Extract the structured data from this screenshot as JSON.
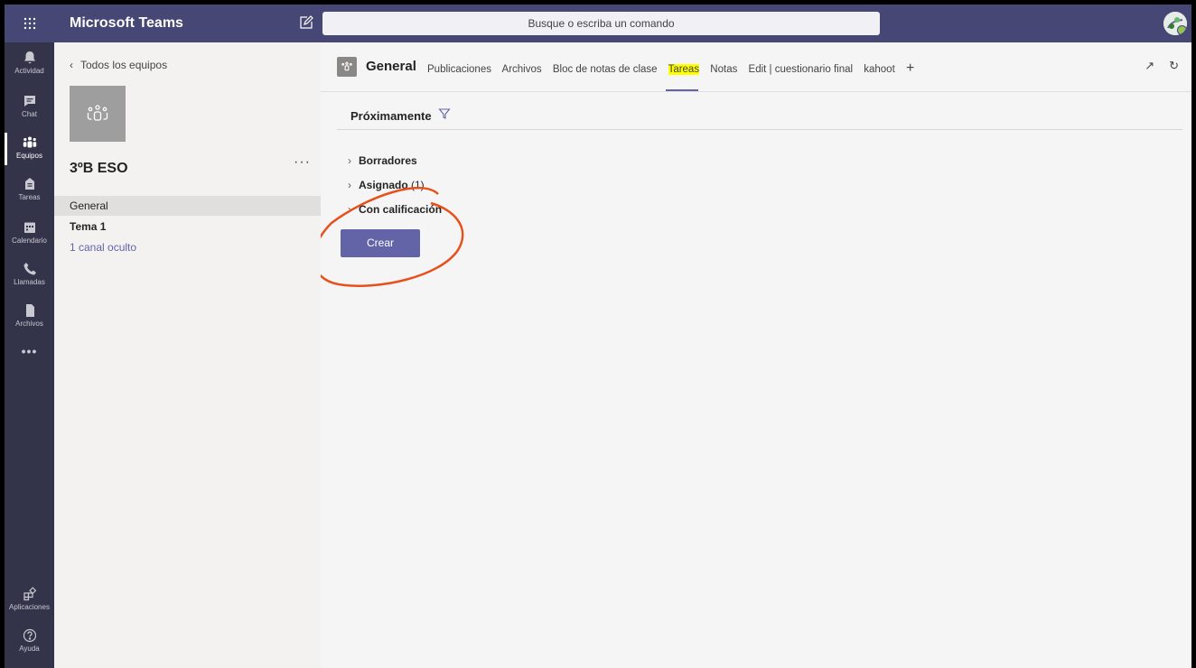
{
  "app": {
    "title": "Microsoft Teams"
  },
  "search": {
    "placeholder": "Busque o escriba un comando"
  },
  "rail": {
    "items": [
      {
        "label": "Actividad",
        "icon": "bell-icon"
      },
      {
        "label": "Chat",
        "icon": "chat-icon"
      },
      {
        "label": "Equipos",
        "icon": "teams-icon"
      },
      {
        "label": "Tareas",
        "icon": "assignments-icon"
      },
      {
        "label": "Calendario",
        "icon": "calendar-icon"
      },
      {
        "label": "Llamadas",
        "icon": "phone-icon"
      },
      {
        "label": "Archivos",
        "icon": "files-icon"
      }
    ],
    "more": "•••",
    "bottom": [
      {
        "label": "Aplicaciones",
        "icon": "apps-icon"
      },
      {
        "label": "Ayuda",
        "icon": "help-icon"
      }
    ]
  },
  "teampanel": {
    "back": "Todos los equipos",
    "team_name": "3ºB ESO",
    "more": "···",
    "channels": [
      {
        "label": "General"
      },
      {
        "label": "Tema 1"
      },
      {
        "label": "1 canal oculto"
      }
    ]
  },
  "channel": {
    "name": "General",
    "tabs": [
      "Publicaciones",
      "Archivos",
      "Bloc de notas de clase",
      "Tareas",
      "Notas",
      "Edit | cuestionario final",
      "kahoot"
    ],
    "add": "+"
  },
  "assignments": {
    "filter_label": "Próximamente",
    "sections": [
      {
        "label": "Borradores",
        "count": ""
      },
      {
        "label": "Asignado",
        "count": "(1)"
      },
      {
        "label": "Con calificación",
        "count": ""
      }
    ],
    "create_button": "Crear"
  },
  "colors": {
    "topbar": "#464775",
    "rail": "#33344a",
    "accent": "#6264a7",
    "annotation": "#e8501b",
    "highlight": "#ffff00"
  }
}
